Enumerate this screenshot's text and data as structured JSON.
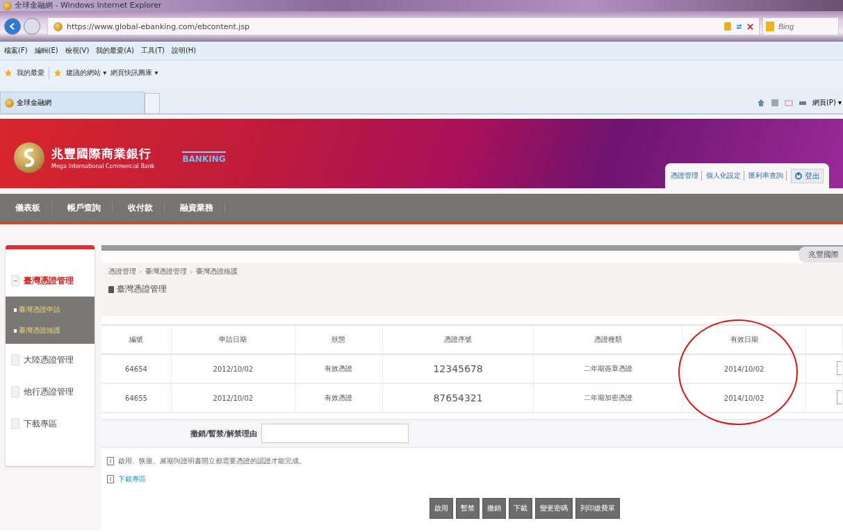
{
  "window": {
    "title": "全球金融網 - Windows Internet Explorer"
  },
  "address_bar": {
    "url": "https://www.global-ebanking.com/ebcontent.jsp"
  },
  "search": {
    "placeholder": "Bing"
  },
  "menu": [
    "檔案(F)",
    "編輯(E)",
    "檢視(V)",
    "我的最愛(A)",
    "工具(T)",
    "說明(H)"
  ],
  "favorites_bar": {
    "favorites": "我的最愛",
    "links": [
      "建議的網站 ▾",
      "網頁快訊圖庫 ▾"
    ]
  },
  "browser_tab": {
    "title": "全球金融網"
  },
  "command_bar": {
    "page_menu": "網頁(P) ▾"
  },
  "bank": {
    "name": "兆豐國際商業銀行",
    "name_en": "Mega International Commercial Bank",
    "banking_logo": "BANKING"
  },
  "top_links": [
    "憑證管理",
    "個人化設定",
    "匯利率查詢"
  ],
  "logout": "登出",
  "nav": [
    "儀表板",
    "帳戶查詢",
    "收付款",
    "融資業務"
  ],
  "content_tab": "兆豐國際",
  "sidebar": {
    "items": [
      {
        "label": "臺灣憑證管理",
        "expanded": true,
        "children": [
          {
            "label": "臺灣憑證申請"
          },
          {
            "label": "臺灣憑證維護"
          }
        ]
      },
      {
        "label": "大陸憑證管理",
        "expanded": false
      },
      {
        "label": "他行憑證管理",
        "expanded": false
      },
      {
        "label": "下載專區",
        "expanded": false
      }
    ]
  },
  "breadcrumb": [
    "憑證管理",
    "臺灣憑證管理",
    "臺灣憑證維護"
  ],
  "heading": "臺灣憑證管理",
  "table": {
    "columns": [
      "編號",
      "申請日期",
      "狀態",
      "憑證序號",
      "憑證種類",
      "有效日期"
    ],
    "rows": [
      {
        "cells": [
          "64654",
          "2012/10/02",
          "有效憑證",
          "12345678",
          "二年期簽章憑證",
          "2014/10/02"
        ],
        "selected": false
      },
      {
        "cells": [
          "64655",
          "2012/10/02",
          "有效憑證",
          "87654321",
          "二年期加密憑證",
          "2014/10/02"
        ],
        "selected": false
      }
    ]
  },
  "reason_field": {
    "label": "撤銷/暫禁/解禁理由"
  },
  "note": "啟用、恢復、展期與證明書開立都需要憑證的認證才能完成。",
  "download_link": "下載專區",
  "buttons": [
    "啟用",
    "暫禁",
    "撤銷",
    "下載",
    "變更密碼",
    "列印繳費單"
  ]
}
